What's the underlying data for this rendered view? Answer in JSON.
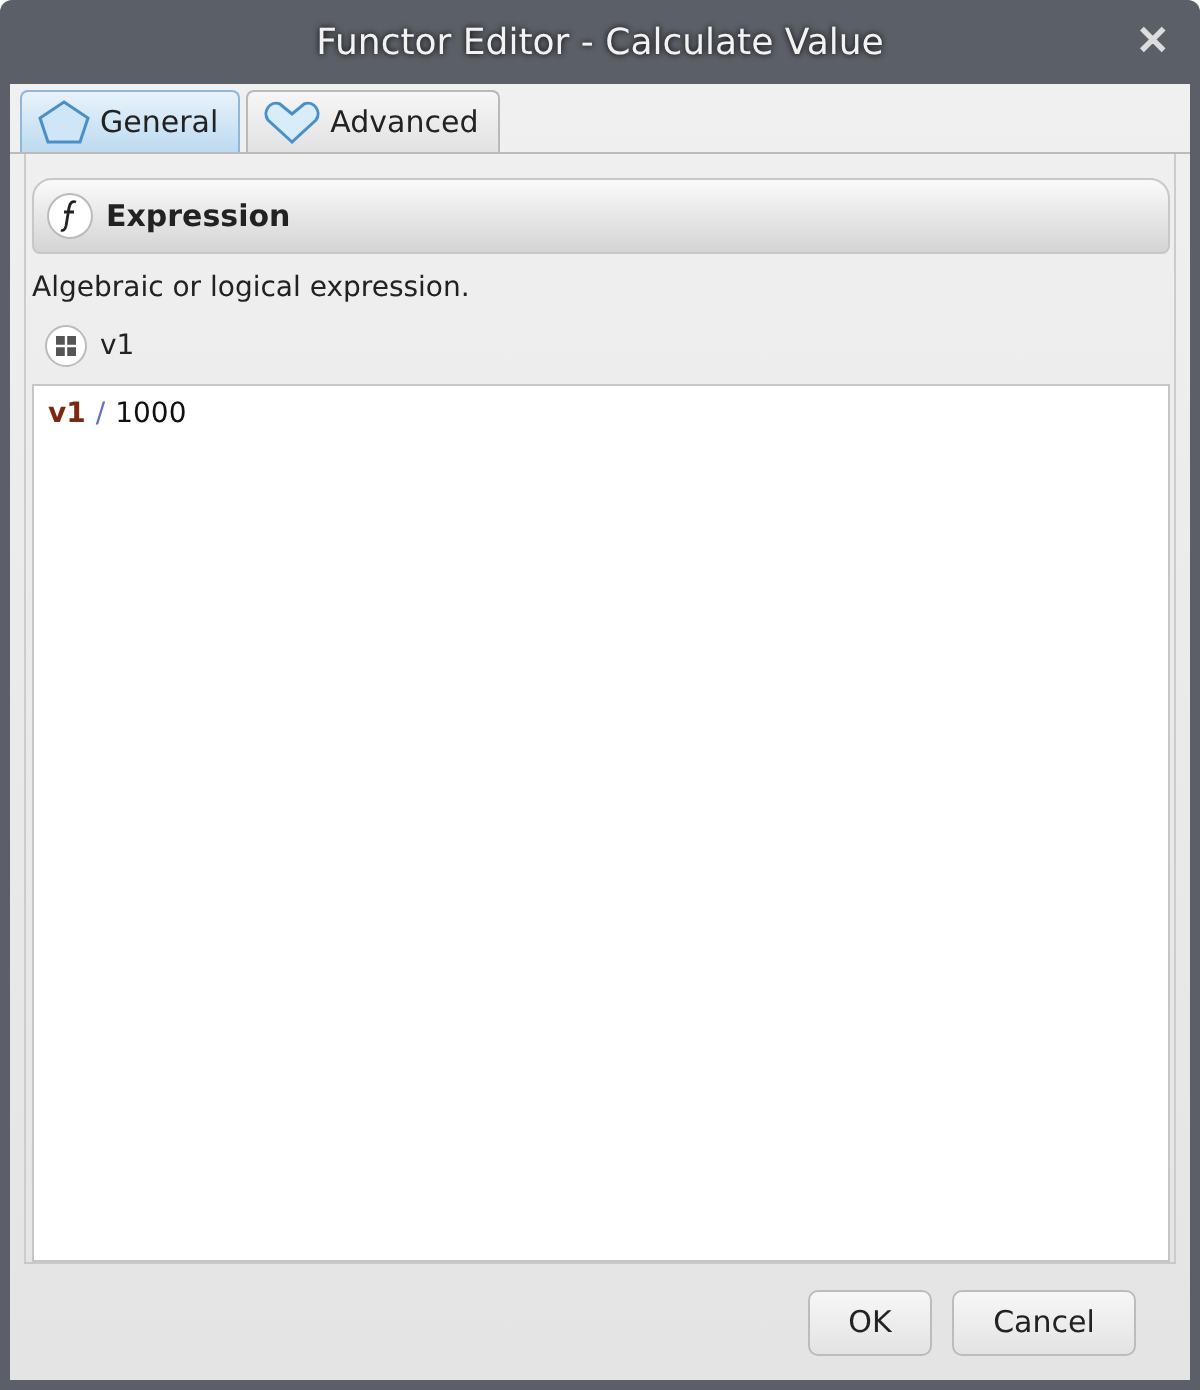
{
  "window": {
    "title": "Functor Editor - Calculate Value",
    "close": "✕"
  },
  "tabs": [
    {
      "label": "General",
      "selected": true
    },
    {
      "label": "Advanced",
      "selected": false
    }
  ],
  "section": {
    "title": "Expression",
    "description": "Algebraic or logical expression."
  },
  "variables": [
    {
      "label": "v1"
    }
  ],
  "expression": [
    {
      "kind": "variable",
      "text": "v1"
    },
    {
      "kind": "operator",
      "text": "/"
    },
    {
      "kind": "number",
      "text": "1000"
    }
  ],
  "buttons": [
    {
      "label": "OK"
    },
    {
      "label": "Cancel"
    }
  ]
}
